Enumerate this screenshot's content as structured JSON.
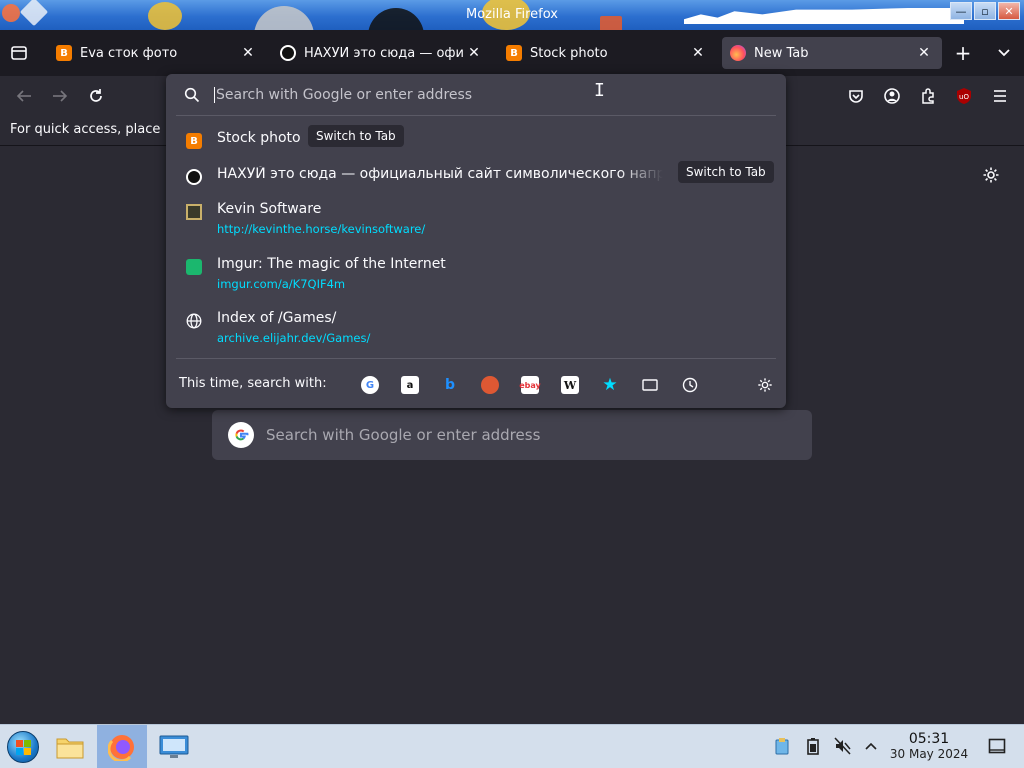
{
  "window": {
    "title": "Mozilla Firefox",
    "buttons": [
      "—",
      "▫",
      "✕"
    ]
  },
  "tabs": [
    {
      "label": "Eva сток фото",
      "favicon": "blogger-icon"
    },
    {
      "label": "НАХУЙ это сюда — офи",
      "favicon": "circle-icon"
    },
    {
      "label": "Stock photo",
      "favicon": "blogger-icon"
    },
    {
      "label": "New Tab",
      "favicon": "firefox-icon",
      "active": true
    }
  ],
  "tab_close_glyph": "✕",
  "new_tab_glyph": "+",
  "bookmarks_toolbar": {
    "text": "For quick access, place"
  },
  "urlbar": {
    "placeholder": "Search with Google or enter address",
    "results": [
      {
        "title": "Stock photo",
        "action": "Switch to Tab",
        "icon": "blogger-icon"
      },
      {
        "title": "НАХУЙ это сюда — официальный сайт символического напр",
        "action": "Switch to Tab",
        "icon": "circle-icon"
      },
      {
        "title": "Kevin Software",
        "url": "http://kevinthe.horse/kevinsoftware/",
        "icon": "pixel-site-icon"
      },
      {
        "title": "Imgur: The magic of the Internet",
        "url": "imgur.com/a/K7QIF4m",
        "icon": "imgur-icon"
      },
      {
        "title": "Index of /Games/",
        "url": "archive.elijahr.dev/Games/",
        "icon": "globe-icon"
      }
    ],
    "search_with_label": "This time, search with:",
    "engines": [
      "google",
      "amazon",
      "bing",
      "duckduckgo",
      "ebay",
      "wikipedia",
      "bookmarks",
      "tabs",
      "history"
    ]
  },
  "newtab": {
    "search_placeholder": "Search with Google or enter address"
  },
  "taskbar": {
    "time": "05:31",
    "date": "30 May 2024"
  }
}
